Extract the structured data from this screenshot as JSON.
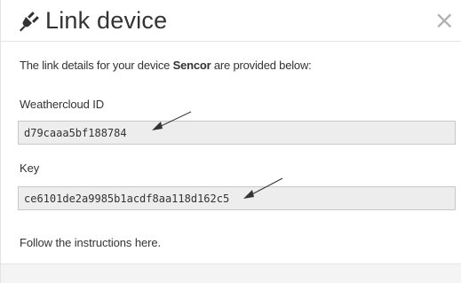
{
  "dialog": {
    "title": "Link device",
    "title_icon": "plug-icon",
    "close_icon": "close-icon",
    "close_label": "×"
  },
  "intro": {
    "prefix": "The link details for your device ",
    "device_name": "Sencor",
    "suffix": " are provided below:"
  },
  "fields": {
    "weathercloud_id": {
      "label": "Weathercloud ID",
      "value": "d79caaa5bf188784"
    },
    "key": {
      "label": "Key",
      "value": "ce6101de2a9985b1acdf8aa118d162c5"
    }
  },
  "instructions": {
    "prefix": "Follow the instructions ",
    "link_text": "here",
    "suffix": "."
  },
  "colors": {
    "input_background": "#ededed",
    "text": "#333333",
    "close_icon": "#b0b0b0"
  }
}
